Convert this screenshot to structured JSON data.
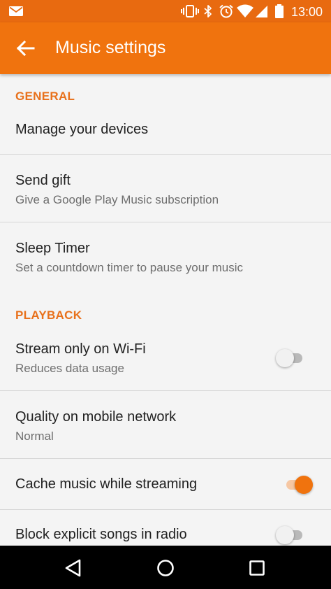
{
  "status_bar": {
    "time": "13:00",
    "icons": [
      "mail-icon",
      "vibrate-icon",
      "bluetooth-icon",
      "alarm-icon",
      "wifi-icon",
      "signal-icon",
      "battery-icon"
    ]
  },
  "app_bar": {
    "title": "Music settings",
    "back_icon": "arrow-back-icon"
  },
  "sections": {
    "general": {
      "header": "GENERAL",
      "items": [
        {
          "title": "Manage your devices"
        },
        {
          "title": "Send gift",
          "subtitle": "Give a Google Play Music subscription"
        },
        {
          "title": "Sleep Timer",
          "subtitle": "Set a countdown timer to pause your music"
        }
      ]
    },
    "playback": {
      "header": "PLAYBACK",
      "items": [
        {
          "title": "Stream only on Wi-Fi",
          "subtitle": "Reduces data usage",
          "toggle": false
        },
        {
          "title": "Quality on mobile network",
          "subtitle": "Normal"
        },
        {
          "title": "Cache music while streaming",
          "toggle": true
        },
        {
          "title": "Block explicit songs in radio",
          "toggle": false
        }
      ]
    }
  },
  "nav_bar": {
    "icons": [
      "back-triangle-icon",
      "home-circle-icon",
      "recents-square-icon"
    ]
  },
  "colors": {
    "accent": "#f0730e",
    "status_bar": "#e86a10",
    "section_header": "#e8711c",
    "background": "#f4f4f4"
  }
}
